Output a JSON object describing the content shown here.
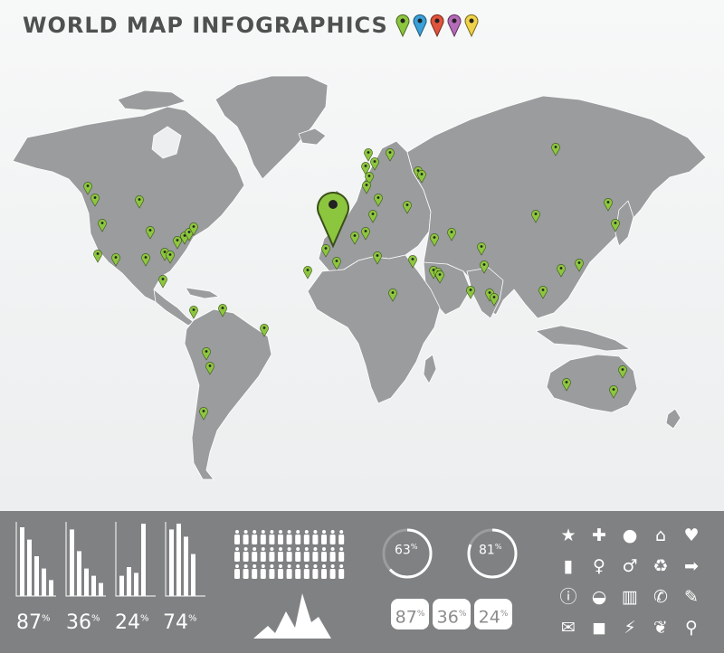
{
  "header": {
    "title": "WORLD MAP INFOGRAPHICS"
  },
  "colors": {
    "land": "#9a9c9e",
    "border": "#ffffff",
    "pin_green": "#8cc63f",
    "pin_blue": "#3aa0d8",
    "pin_red": "#e0533d",
    "pin_purple": "#b66bb8",
    "pin_yellow": "#f0d24a",
    "panel": "#7f8182"
  },
  "legend": {
    "pins": [
      "green",
      "blue",
      "red",
      "purple",
      "yellow"
    ]
  },
  "map": {
    "focus_pin": {
      "region": "iberia",
      "icon": "map-pin-icon"
    },
    "pin_count": 60
  },
  "stats": {
    "bars": [
      {
        "label": "87",
        "unit": "%",
        "values": [
          0.95,
          0.78,
          0.55,
          0.38,
          0.22
        ]
      },
      {
        "label": "36",
        "unit": "%",
        "values": [
          0.92,
          0.62,
          0.38,
          0.28,
          0.18
        ]
      },
      {
        "label": "24",
        "unit": "%",
        "values": [
          0.28,
          0.4,
          0.32,
          1.0
        ]
      },
      {
        "label": "74",
        "unit": "%",
        "values": [
          0.92,
          1.0,
          0.82,
          0.58
        ]
      }
    ],
    "people_rows": 3,
    "rings": [
      {
        "label": "63",
        "unit": "%",
        "fraction": 0.63
      },
      {
        "label": "81",
        "unit": "%",
        "fraction": 0.81
      }
    ],
    "tiles": [
      {
        "label": "87",
        "unit": "%"
      },
      {
        "label": "36",
        "unit": "%"
      },
      {
        "label": "24",
        "unit": "%"
      }
    ]
  },
  "icons": [
    {
      "name": "star-icon",
      "glyph": "★"
    },
    {
      "name": "plus-icon",
      "glyph": "✚"
    },
    {
      "name": "person-icon",
      "glyph": "●"
    },
    {
      "name": "home-icon",
      "glyph": "⌂"
    },
    {
      "name": "heart-icon",
      "glyph": "♥"
    },
    {
      "name": "fuel-pump-icon",
      "glyph": "▮"
    },
    {
      "name": "woman-icon",
      "glyph": "♀"
    },
    {
      "name": "man-icon",
      "glyph": "♂"
    },
    {
      "name": "recycle-icon",
      "glyph": "♻"
    },
    {
      "name": "arrow-right-icon",
      "glyph": "➡"
    },
    {
      "name": "info-icon",
      "glyph": "ⓘ"
    },
    {
      "name": "burger-icon",
      "glyph": "◒"
    },
    {
      "name": "factory-icon",
      "glyph": "▥"
    },
    {
      "name": "phone-icon",
      "glyph": "✆"
    },
    {
      "name": "pushpin-icon",
      "glyph": "✎"
    },
    {
      "name": "mail-icon",
      "glyph": "✉"
    },
    {
      "name": "car-icon",
      "glyph": "◼"
    },
    {
      "name": "plug-icon",
      "glyph": "⚡"
    },
    {
      "name": "leaf-icon",
      "glyph": "❦"
    },
    {
      "name": "water-tap-icon",
      "glyph": "⚲"
    }
  ]
}
